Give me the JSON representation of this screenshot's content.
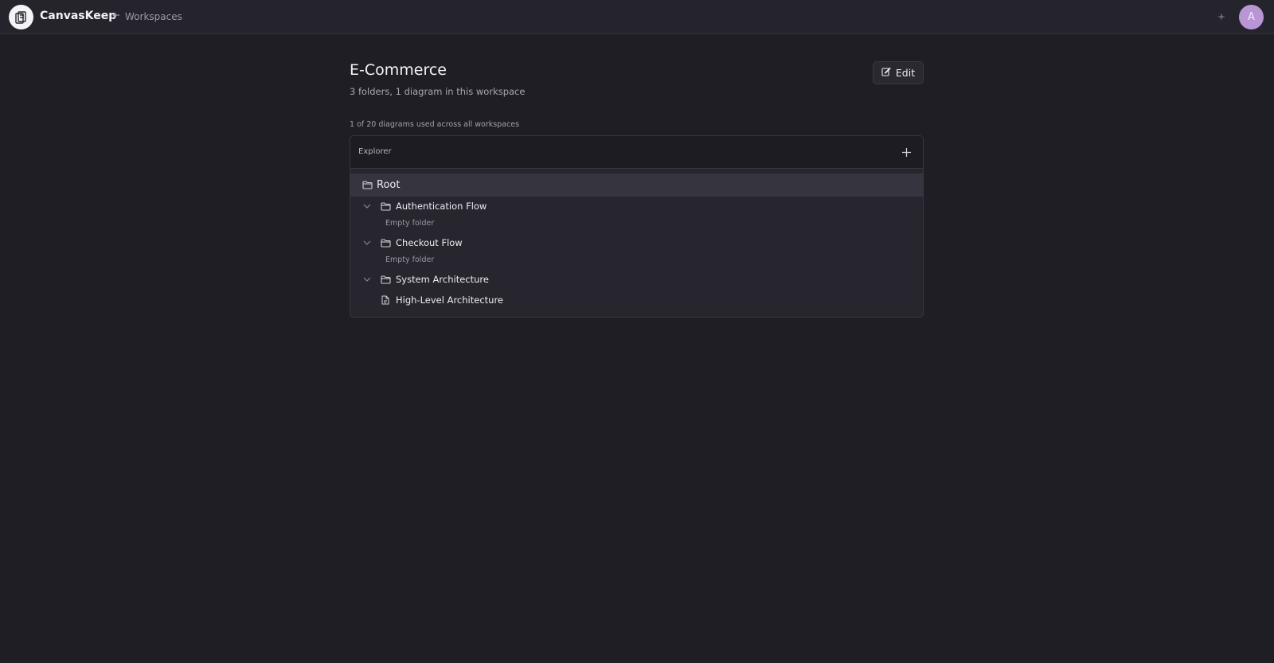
{
  "app": {
    "name": "CanvasKeep",
    "back_label": "Workspaces",
    "avatar_initial": "A",
    "icons": {
      "logo": "canvaskeep-logo-icon",
      "back": "arrow-left-icon",
      "sparkle": "sparkle-icon"
    }
  },
  "workspace": {
    "title": "E-Commerce",
    "subtitle": "3 folders, 1 diagram in this workspace",
    "edit_label": "Edit",
    "usage": "1 of 20 diagrams used across all workspaces"
  },
  "explorer": {
    "title": "Explorer",
    "root_label": "Root",
    "folders": [
      {
        "label": "Authentication Flow",
        "empty_text": "Empty folder"
      },
      {
        "label": "Checkout Flow",
        "empty_text": "Empty folder"
      },
      {
        "label": "System Architecture",
        "diagrams": [
          "High-Level Architecture"
        ]
      }
    ]
  },
  "colors": {
    "background": "#1f1e24",
    "topbar": "#25242d",
    "panel": "#27262e",
    "root_highlight": "#36353f",
    "avatar": "#b896d6"
  }
}
